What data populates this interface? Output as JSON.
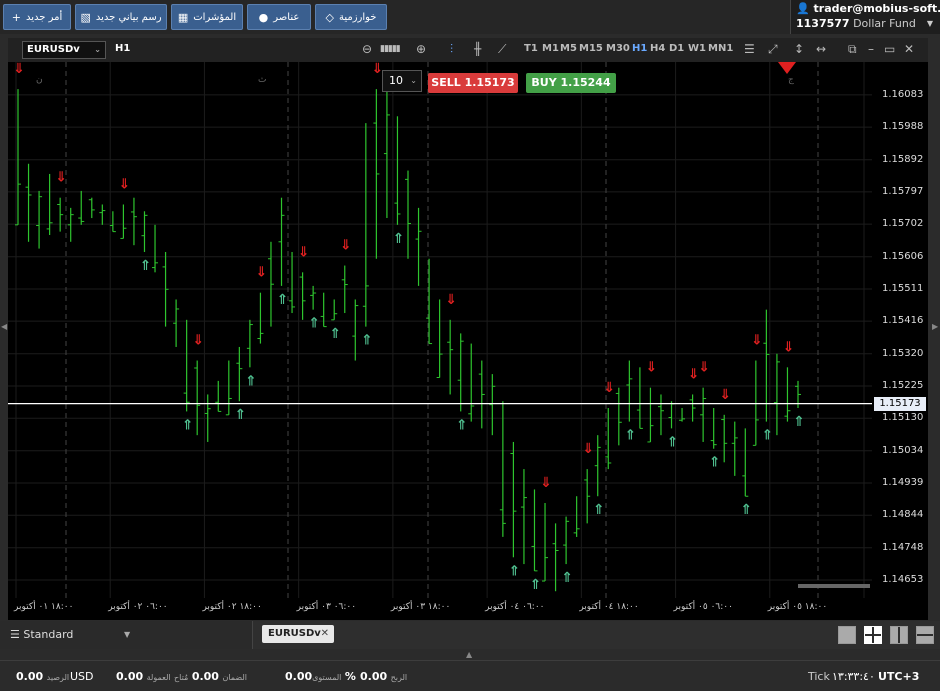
{
  "toolbar": {
    "buttons": [
      {
        "label": "أمر جديد",
        "icon": "plus-icon",
        "glyph": "+"
      },
      {
        "label": "رسم بياني جديد",
        "icon": "chart-icon",
        "glyph": "📈"
      },
      {
        "label": "المؤشرات",
        "icon": "indicators-icon",
        "glyph": "▦"
      },
      {
        "label": "عناصر",
        "icon": "objects-icon",
        "glyph": "●"
      },
      {
        "label": "خوارزمية",
        "icon": "algorithm-icon",
        "glyph": "◇"
      }
    ]
  },
  "account": {
    "user": "trader@mobius-soft.org",
    "id": "1137577",
    "fund": "Dollar Fund"
  },
  "chart": {
    "symbol": "EURUSDv",
    "period": "H1",
    "timeframes": [
      "T1",
      "M1",
      "M5",
      "M15",
      "M30",
      "H1",
      "H4",
      "D1",
      "W1",
      "MN1"
    ],
    "active_timeframe": "H1",
    "quantity": "10",
    "sell_label": "SELL",
    "sell_price": "1.15173",
    "buy_label": "BUY",
    "buy_price": "1.15244",
    "current_price": "1.15173",
    "y_ticks": [
      "1.16083",
      "1.15988",
      "1.15892",
      "1.15797",
      "1.15702",
      "1.15606",
      "1.15511",
      "1.15416",
      "1.15320",
      "1.15225",
      "1.15130",
      "1.15034",
      "1.14939",
      "1.14844",
      "1.14748",
      "1.14653"
    ],
    "x_ticks": [
      "١٨:٠٠ ٠١ أكتوبر",
      "٠٦:٠٠ ٠٢ أكتوبر",
      "١٨:٠٠ ٠٢ أكتوبر",
      "٠٦:٠٠ ٠٣ أكتوبر",
      "١٨:٠٠ ٠٣ أكتوبر",
      "٠٦:٠٠ ٠٤ أكتوبر",
      "١٨:٠٠ ٠٤ أكتوبر",
      "٠٦:٠٠ ٠٥ أكتوبر",
      "١٨:٠٠ ٠٥ أكتوبر"
    ],
    "day_marks": [
      "ن",
      "ث",
      "ر",
      "خ",
      "ج"
    ],
    "colors": {
      "bull": "#2ec52e",
      "bear": "#2ec52e",
      "down_arrow": "#e02020",
      "up_arrow": "#4fbf8f",
      "price_line": "#ffffff",
      "grid": "#1c1c1c"
    }
  },
  "chart_data": {
    "type": "candlestick",
    "symbol": "EURUSDv",
    "timeframe": "H1",
    "ylim": [
      1.146,
      1.1618
    ],
    "current_price": 1.15173,
    "bars_hl": [
      [
        1.161,
        1.157
      ],
      [
        1.1588,
        1.1565
      ],
      [
        1.158,
        1.1563
      ],
      [
        1.1585,
        1.1567
      ],
      [
        1.1578,
        1.1568
      ],
      [
        1.1575,
        1.1565
      ],
      [
        1.158,
        1.157
      ],
      [
        1.1578,
        1.1572
      ],
      [
        1.1576,
        1.157
      ],
      [
        1.1574,
        1.1568
      ],
      [
        1.1576,
        1.1566
      ],
      [
        1.1578,
        1.1564
      ],
      [
        1.1574,
        1.1562
      ],
      [
        1.157,
        1.1556
      ],
      [
        1.1562,
        1.154
      ],
      [
        1.1548,
        1.1534
      ],
      [
        1.1542,
        1.1515
      ],
      [
        1.153,
        1.1508
      ],
      [
        1.152,
        1.1506
      ],
      [
        1.1524,
        1.1515
      ],
      [
        1.153,
        1.1514
      ],
      [
        1.1534,
        1.1518
      ],
      [
        1.1542,
        1.1528
      ],
      [
        1.155,
        1.1535
      ],
      [
        1.1565,
        1.154
      ],
      [
        1.1578,
        1.1552
      ],
      [
        1.1562,
        1.1544
      ],
      [
        1.1556,
        1.1542
      ],
      [
        1.1552,
        1.1545
      ],
      [
        1.155,
        1.154
      ],
      [
        1.1548,
        1.1542
      ],
      [
        1.1558,
        1.1544
      ],
      [
        1.1548,
        1.153
      ],
      [
        1.16,
        1.154
      ],
      [
        1.161,
        1.156
      ],
      [
        1.161,
        1.1572
      ],
      [
        1.1602,
        1.157
      ],
      [
        1.1586,
        1.156
      ],
      [
        1.1575,
        1.1552
      ],
      [
        1.156,
        1.1535
      ],
      [
        1.1548,
        1.1525
      ],
      [
        1.1542,
        1.152
      ],
      [
        1.1538,
        1.1515
      ],
      [
        1.1535,
        1.1512
      ],
      [
        1.153,
        1.151
      ],
      [
        1.1526,
        1.1508
      ],
      [
        1.1518,
        1.1478
      ],
      [
        1.1506,
        1.1472
      ],
      [
        1.1498,
        1.147
      ],
      [
        1.1492,
        1.1468
      ],
      [
        1.1488,
        1.1465
      ],
      [
        1.1482,
        1.1462
      ],
      [
        1.1484,
        1.147
      ],
      [
        1.149,
        1.1478
      ],
      [
        1.1498,
        1.1482
      ],
      [
        1.1508,
        1.149
      ],
      [
        1.1516,
        1.1498
      ],
      [
        1.1522,
        1.1505
      ],
      [
        1.153,
        1.1512
      ],
      [
        1.1528,
        1.151
      ],
      [
        1.1522,
        1.1506
      ],
      [
        1.152,
        1.1508
      ],
      [
        1.1518,
        1.151
      ],
      [
        1.1516,
        1.1512
      ],
      [
        1.152,
        1.1512
      ],
      [
        1.1522,
        1.1506
      ],
      [
        1.1516,
        1.1504
      ],
      [
        1.1514,
        1.15
      ],
      [
        1.1512,
        1.1496
      ],
      [
        1.151,
        1.149
      ],
      [
        1.153,
        1.1505
      ],
      [
        1.1545,
        1.1512
      ],
      [
        1.1532,
        1.1508
      ],
      [
        1.1528,
        1.1512
      ],
      [
        1.1524,
        1.1516
      ]
    ],
    "down_signals": [
      0,
      4,
      10,
      17,
      23,
      27,
      31,
      34,
      41,
      50,
      54,
      56,
      60,
      64,
      65,
      67,
      70,
      73,
      75
    ],
    "up_signals": [
      12,
      16,
      21,
      22,
      25,
      28,
      30,
      33,
      36,
      42,
      47,
      49,
      52,
      55,
      58,
      62,
      66,
      69,
      71,
      74
    ]
  },
  "tabs": {
    "workspace": "Standard",
    "chart_tab": "EURUSDv"
  },
  "status": {
    "balance_value": "0.00",
    "balance_label": "الرصيد",
    "currency": "USD",
    "commission_value": "0.00",
    "commission_label": "العمولة",
    "margin_value": "0.00",
    "margin_label": "الضمان",
    "free_label": "مُتاح",
    "level_value": "0.00",
    "level_label": "المستوى",
    "percent": "%",
    "profit_value": "0.00",
    "profit_label": "الربح",
    "tick_label": "Tick",
    "time": "١٣:٣٣:٤٠",
    "timezone": "UTC+3"
  }
}
